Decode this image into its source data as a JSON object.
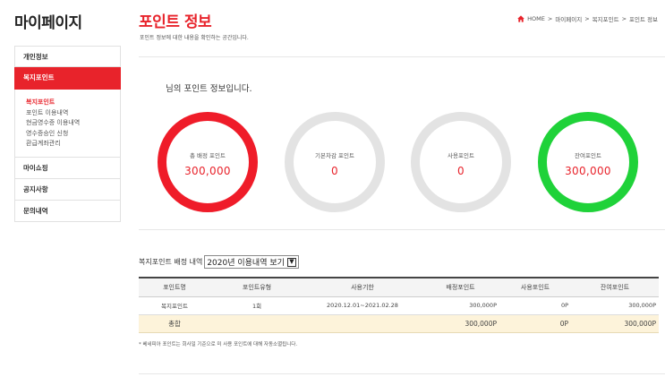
{
  "sidebar": {
    "title": "마이페이지",
    "menu": [
      {
        "label": "개인정보"
      },
      {
        "label": "복지포인트"
      }
    ],
    "sub_items": [
      "복지포인트",
      "포인트 이용내역",
      "현금영수증 이용내역",
      "영수증승인 신청",
      "환급계좌관리"
    ],
    "menu_after": [
      {
        "label": "마이쇼핑"
      },
      {
        "label": "공지사항"
      },
      {
        "label": "문의내역"
      }
    ]
  },
  "header": {
    "title": "포인트 정보",
    "description": "포인트 정보에 대한 내용을 확인하는 공간입니다.",
    "breadcrumb": [
      "HOME",
      ">",
      "마이페이지",
      ">",
      "복지포인트",
      ">",
      "포인트 정보"
    ]
  },
  "summary": {
    "intro": "님의 포인트 정보입니다.",
    "cards": [
      {
        "label": "총 배정 포인트",
        "value": "300,000",
        "ring_color": "#ef1c29"
      },
      {
        "label": "기본차감 포인트",
        "value": "0",
        "ring_color": "#e3e3e3"
      },
      {
        "label": "사용포인트",
        "value": "0",
        "ring_color": "#e3e3e3"
      },
      {
        "label": "잔여포인트",
        "value": "300,000",
        "ring_color": "#1fd239"
      }
    ]
  },
  "history": {
    "label": "복지포인트 배정 내역",
    "select_value": "2020년 이용내역 보기",
    "columns": [
      "포인트명",
      "포인트유형",
      "사용기한",
      "배정포인트",
      "사용포인트",
      "잔여포인트"
    ],
    "rows": [
      [
        "복지포인트",
        "1회",
        "2020.12.01~2021.02.28",
        "300,000P",
        "0P",
        "300,000P"
      ]
    ],
    "total": {
      "label": "총합",
      "assigned": "300,000P",
      "used": "0P",
      "remaining": "300,000P"
    }
  },
  "note": "* 베네피아 포인트는 회사일 기준으로 미 사용 포인트에 대해 자동소멸됩니다.",
  "colors": {
    "accent": "#e8232b",
    "green": "#1fd239",
    "gray_ring": "#e3e3e3"
  }
}
